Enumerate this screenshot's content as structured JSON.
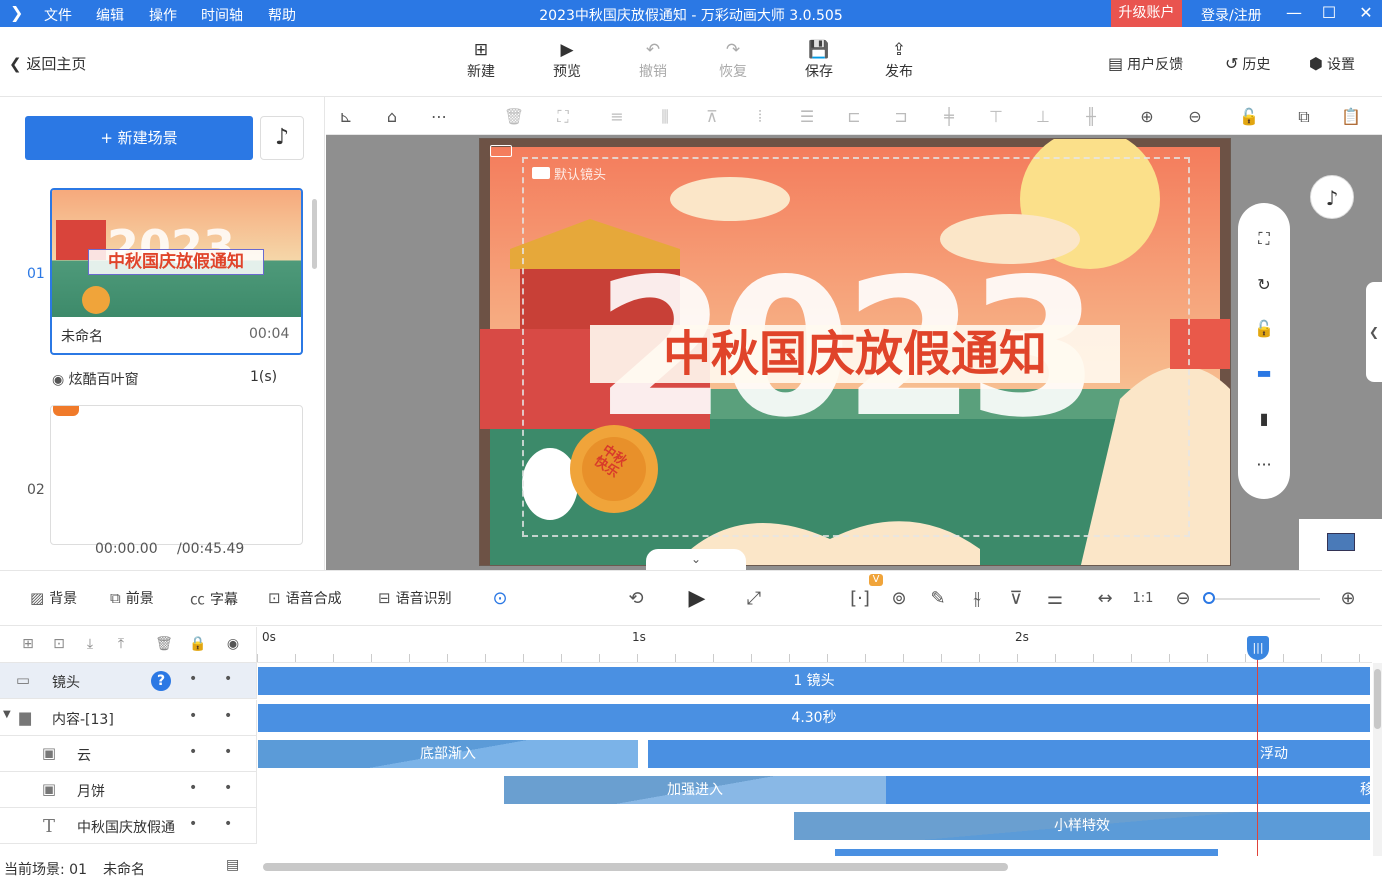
{
  "menubar": {
    "items": [
      "文件",
      "编辑",
      "操作",
      "时间轴",
      "帮助"
    ],
    "title": "2023中秋国庆放假通知 - 万彩动画大师 3.0.505",
    "upgrade": "升级账户",
    "login": "登录/注册"
  },
  "toolbar": {
    "back": "返回主页",
    "buttons": [
      "新建",
      "预览",
      "撤销",
      "恢复",
      "保存",
      "发布"
    ],
    "right": [
      "用户反馈",
      "历史",
      "设置"
    ]
  },
  "left": {
    "new_scene": "新建场景",
    "scenes": [
      {
        "num": "01",
        "name": "未命名",
        "duration": "00:04",
        "transition": "炫酷百叶窗",
        "transition_dur": "1(s)"
      },
      {
        "num": "02"
      }
    ],
    "time_current": "00:00.00",
    "time_total": "/00:45.49"
  },
  "stage": {
    "camera_label": "默认镜头",
    "year": "2023",
    "headline": "中秋国庆放假通知",
    "mooncake_text": "中秋快乐"
  },
  "timeline": {
    "tools": [
      "背景",
      "前景",
      "字幕",
      "语音合成",
      "语音识别"
    ],
    "ruler": [
      "0s",
      "1s",
      "2s"
    ],
    "badge": "V",
    "layers": [
      {
        "name": "镜头",
        "bar": "1 镜头"
      },
      {
        "name": "内容-[13]",
        "bar": "4.30秒"
      },
      {
        "name": "云",
        "bar1": "底部渐入",
        "bar2": "浮动"
      },
      {
        "name": "月饼",
        "bar1": "加强进入",
        "bar2": "移"
      },
      {
        "name": "中秋国庆放假通",
        "bar1": "小样特效"
      }
    ]
  },
  "status": {
    "current_scene": "当前场景: 01",
    "scene_name": "未命名"
  }
}
